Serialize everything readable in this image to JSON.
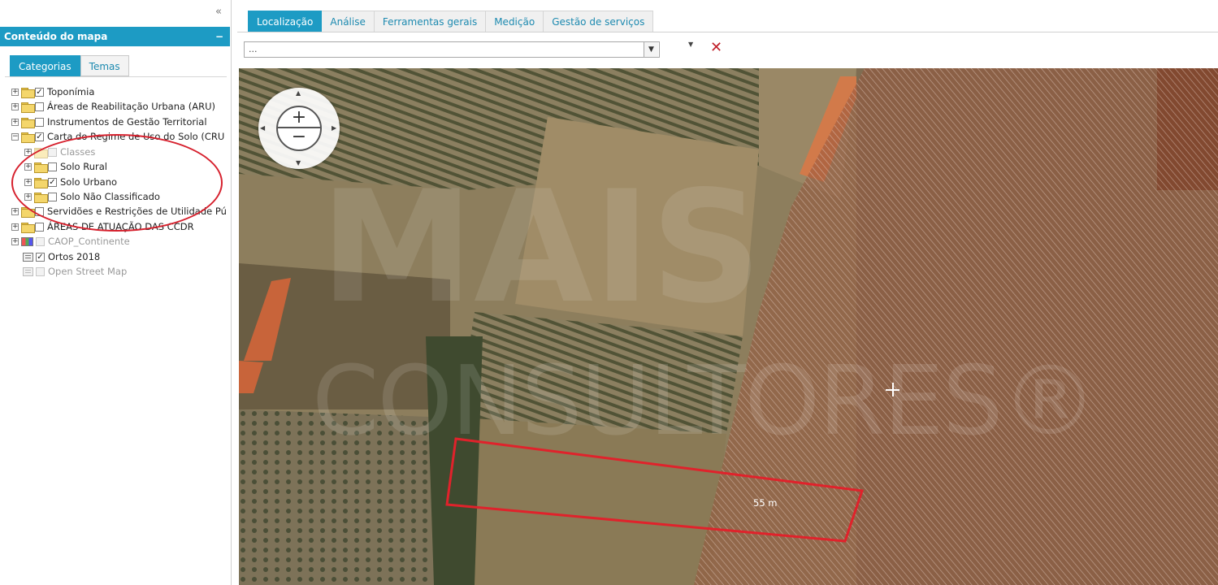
{
  "sidebar": {
    "header": "Conteúdo do mapa",
    "minimize": "−",
    "collapse": "«",
    "tabs": [
      {
        "label": "Categorias",
        "active": true
      },
      {
        "label": "Temas",
        "active": false
      }
    ],
    "tree": [
      {
        "label": "Toponímia",
        "checked": true,
        "enabled": true
      },
      {
        "label": "Áreas de Reabilitação Urbana (ARU)",
        "checked": false,
        "enabled": true
      },
      {
        "label": "Instrumentos de Gestão Territorial",
        "checked": false,
        "enabled": true
      },
      {
        "label": "Carta do Regime de Uso do Solo (CRU",
        "checked": true,
        "enabled": true
      },
      {
        "label": "Classes",
        "checked": false,
        "enabled": false
      },
      {
        "label": "Solo Rural",
        "checked": false,
        "enabled": true
      },
      {
        "label": "Solo Urbano",
        "checked": true,
        "enabled": true
      },
      {
        "label": "Solo Não Classificado",
        "checked": false,
        "enabled": true
      },
      {
        "label": "Servidões e Restrições de Utilidade Pú",
        "checked": false,
        "enabled": true
      },
      {
        "label": "ÁREAS DE ATUAÇÃO DAS CCDR",
        "checked": false,
        "enabled": true
      },
      {
        "label": "CAOP_Continente",
        "checked": false,
        "enabled": false
      },
      {
        "label": "Ortos 2018",
        "checked": true,
        "enabled": true
      },
      {
        "label": "Open Street Map",
        "checked": false,
        "enabled": false
      }
    ]
  },
  "toolbar": {
    "tabs": [
      {
        "label": "Localização",
        "active": true
      },
      {
        "label": "Análise",
        "active": false
      },
      {
        "label": "Ferramentas gerais",
        "active": false
      },
      {
        "label": "Medição",
        "active": false
      },
      {
        "label": "Gestão de serviços",
        "active": false
      }
    ],
    "search_value": "...",
    "dropdown_arrow": "▼",
    "small_caret": "▼",
    "clear_label": "✕"
  },
  "map": {
    "zoom_in": "+",
    "zoom_out": "−",
    "measure_label": "55 m",
    "watermark_line1": "MAIS",
    "watermark_line2": "CONSULTORES®",
    "colors": {
      "hatch": "#b36a4c",
      "measure": "#e0222b",
      "accent": "#1d9bc4"
    }
  }
}
